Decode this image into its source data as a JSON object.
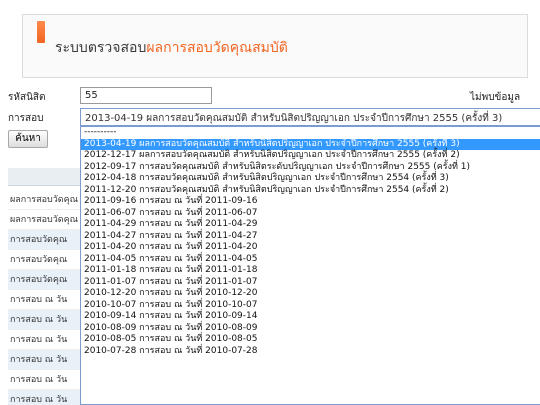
{
  "header": {
    "title_prefix": "ระบบตรวจสอบ",
    "title_highlight": "ผลการสอบวัดคุณสมบัติ"
  },
  "form": {
    "student_id_label": "รหัสนิสิต",
    "student_id_value": "55",
    "status_text": "ไม่พบข้อมูล",
    "exam_label": "การสอบ",
    "exam_selected": "2013-04-19 ผลการสอบวัดคุณสมบัติ สำหรับนิสิตปริญญาเอก ประจำปีการศึกษา 2555 (ครั้งที่ 3)",
    "search_button": "ค้นหา"
  },
  "dropdown_options": [
    "----------",
    "2013-04-19 ผลการสอบวัดคุณสมบัติ สำหรับนิสิตปริญญาเอก ประจำปีการศึกษา 2555 (ครั้งที่ 3)",
    "2012-12-17 ผลการสอบวัดคุณสมบัติ สำหรับนิสิตปริญญาเอก ประจำปีการศึกษา 2555 (ครั้งที่ 2)",
    "2012-09-17 การสอบวัดคุณสมบัติ สำหรับนิสิตระดับปริญญาเอก ประจำปีการศึกษา 2555 (ครั้งที่ 1)",
    "2012-04-18 การสอบวัดคุณสมบัติ สำหรับนิสิตปริญญาเอก ประจำปีการศึกษา 2554 (ครั้งที่ 3)",
    "2011-12-20 การสอบวัดคุณสมบัติ สำหรับนิสิตปริญญาเอก ประจำปีการศึกษา 2554 (ครั้งที่ 2)",
    "2011-09-16 การสอบ ณ วันที่ 2011-09-16",
    "2011-06-07 การสอบ ณ วันที่ 2011-06-07",
    "2011-04-29 การสอบ ณ วันที่ 2011-04-29",
    "2011-04-27 การสอบ ณ วันที่ 2011-04-27",
    "2011-04-20 การสอบ ณ วันที่ 2011-04-20",
    "2011-04-05 การสอบ ณ วันที่ 2011-04-05",
    "2011-01-18 การสอบ ณ วันที่ 2011-01-18",
    "2011-01-07 การสอบ ณ วันที่ 2011-01-07",
    "2010-12-20 การสอบ ณ วันที่ 2010-12-20",
    "2010-10-07 การสอบ ณ วันที่ 2010-10-07",
    "2010-09-14 การสอบ ณ วันที่ 2010-09-14",
    "2010-08-09 การสอบ ณ วันที่ 2010-08-09",
    "2010-08-05 การสอบ ณ วันที่ 2010-08-05",
    "2010-07-28 การสอบ ณ วันที่ 2010-07-28"
  ],
  "selected_index": 1,
  "result_rows": [
    "ผลการสอบวัดคุณ",
    "ผลการสอบวัดคุณ",
    "การสอบวัดคุณ",
    "การสอบวัดคุณ",
    "การสอบวัดคุณ",
    "การสอบ ณ วัน",
    "การสอบ ณ วัน",
    "การสอบ ณ วัน",
    "การสอบ ณ วัน",
    "การสอบ ณ วัน",
    "การสอบ ณ วัน"
  ]
}
